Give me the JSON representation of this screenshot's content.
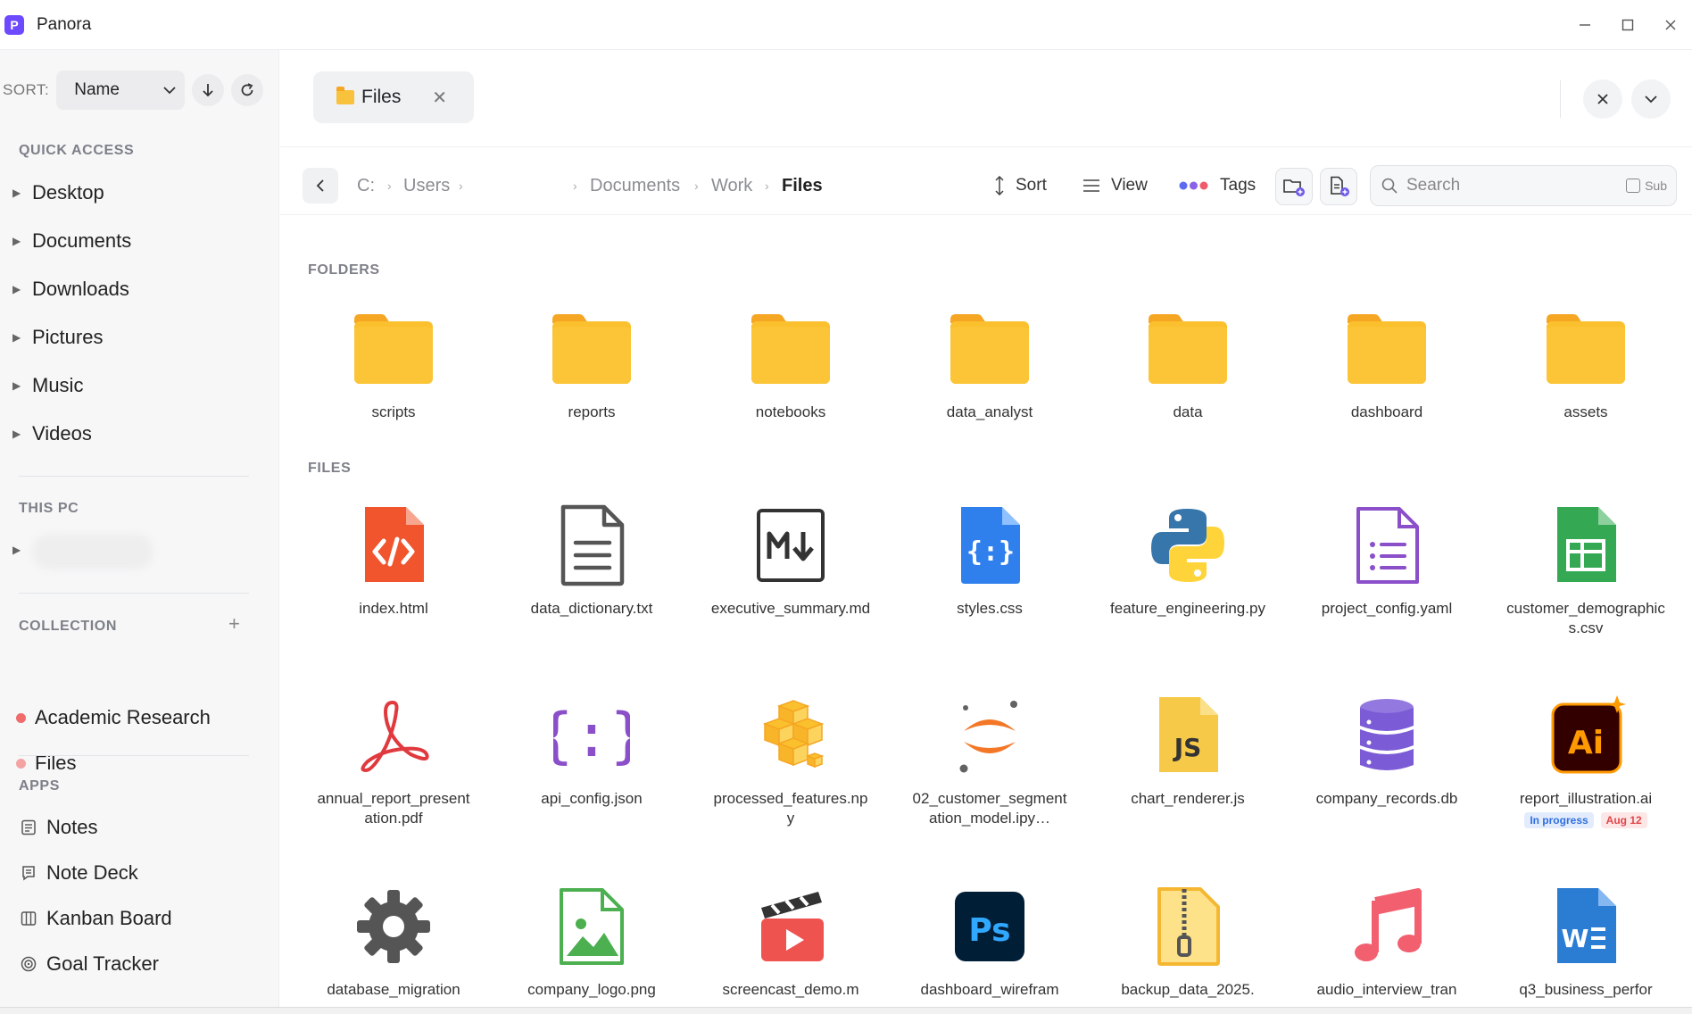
{
  "app": {
    "logo_letter": "P",
    "title": "Panora"
  },
  "sidebar": {
    "sort_label": "SORT:",
    "sort_value": "Name",
    "quick_access_title": "QUICK ACCESS",
    "quick_access": [
      "Desktop",
      "Documents",
      "Downloads",
      "Pictures",
      "Music",
      "Videos"
    ],
    "this_pc_title": "THIS PC",
    "collection_title": "COLLECTION",
    "collections": [
      {
        "label": "Academic Research",
        "color": "#f06b6b"
      },
      {
        "label": "Files",
        "color": "#f4a2a2"
      }
    ],
    "apps_title": "APPS",
    "apps": [
      "Notes",
      "Note Deck",
      "Kanban Board",
      "Goal Tracker"
    ]
  },
  "tab": {
    "label": "Files"
  },
  "breadcrumb": [
    "C:",
    "Users",
    "Documents",
    "Work",
    "Files"
  ],
  "toolbar": {
    "sort": "Sort",
    "view": "View",
    "tags": "Tags",
    "search_placeholder": "Search",
    "sub_label": "Sub"
  },
  "folders_title": "FOLDERS",
  "folders": [
    "scripts",
    "reports",
    "notebooks",
    "data_analyst",
    "data",
    "dashboard",
    "assets"
  ],
  "files_title": "FILES",
  "files": [
    {
      "name": "index.html",
      "icon": "html-icon"
    },
    {
      "name": "data_dictionary.txt",
      "icon": "text-file-icon"
    },
    {
      "name": "executive_summary.md",
      "icon": "markdown-icon"
    },
    {
      "name": "styles.css",
      "icon": "css-icon"
    },
    {
      "name": "feature_engineering.py",
      "icon": "python-icon"
    },
    {
      "name": "project_config.yaml",
      "icon": "yaml-icon"
    },
    {
      "name": "customer_demographics.csv",
      "icon": "csv-icon"
    },
    {
      "name": "annual_report_presentation.pdf",
      "icon": "pdf-icon"
    },
    {
      "name": "api_config.json",
      "icon": "json-icon"
    },
    {
      "name": "processed_features.npy",
      "icon": "npy-icon"
    },
    {
      "name": "02_customer_segmentation_model.ipy…",
      "icon": "jupyter-icon"
    },
    {
      "name": "chart_renderer.js",
      "icon": "js-icon"
    },
    {
      "name": "company_records.db",
      "icon": "database-icon"
    },
    {
      "name": "report_illustration.ai",
      "icon": "illustrator-icon",
      "badges": [
        {
          "label": "In progress",
          "fg": "#2f6fe0",
          "bg": "#e3ecfc"
        },
        {
          "label": "Aug 12",
          "fg": "#e0474c",
          "bg": "#fde6e6"
        }
      ]
    },
    {
      "name": "database_migration",
      "icon": "gear-icon"
    },
    {
      "name": "company_logo.png",
      "icon": "image-icon"
    },
    {
      "name": "screencast_demo.m",
      "icon": "video-icon"
    },
    {
      "name": "dashboard_wirefram",
      "icon": "photoshop-icon"
    },
    {
      "name": "backup_data_2025.",
      "icon": "zip-icon"
    },
    {
      "name": "audio_interview_tran",
      "icon": "music-icon"
    },
    {
      "name": "q3_business_perfor",
      "icon": "word-icon"
    }
  ]
}
